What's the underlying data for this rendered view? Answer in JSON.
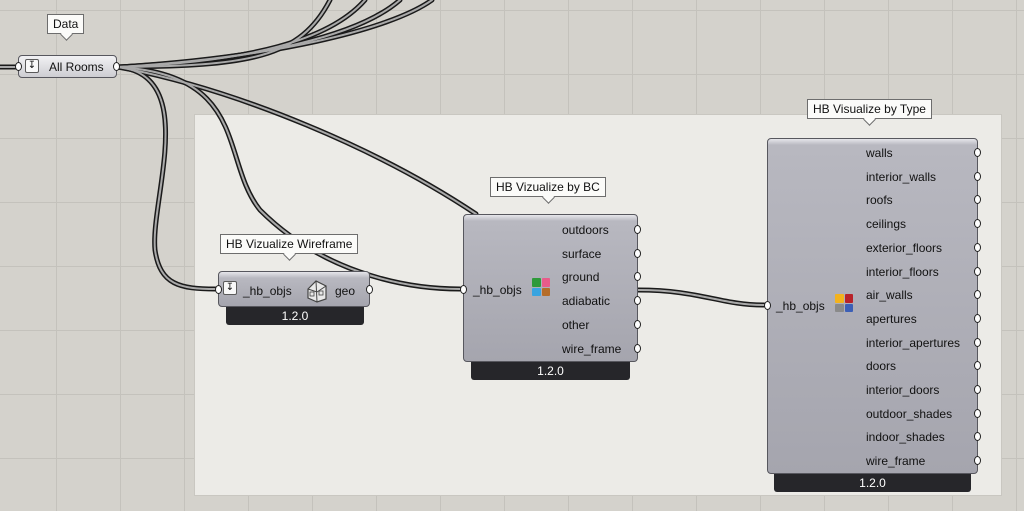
{
  "data_param": {
    "tag": "Data",
    "label": "All Rooms"
  },
  "wireframe": {
    "tag": "HB Vizualize Wireframe",
    "input": "_hb_objs",
    "output": "geo",
    "version": "1.2.0",
    "icon": "house-icon"
  },
  "by_bc": {
    "tag": "HB Vizualize by BC",
    "input": "_hb_objs",
    "outputs": [
      "outdoors",
      "surface",
      "ground",
      "adiabatic",
      "other",
      "wire_frame"
    ],
    "version": "1.2.0",
    "icon_colors": [
      "#2e9a3a",
      "#e85c8a",
      "#39a4e0",
      "#b56d2a"
    ]
  },
  "by_type": {
    "tag": "HB Visualize by Type",
    "input": "_hb_objs",
    "outputs": [
      "walls",
      "interior_walls",
      "roofs",
      "ceilings",
      "exterior_floors",
      "interior_floors",
      "air_walls",
      "apertures",
      "interior_apertures",
      "doors",
      "interior_doors",
      "outdoor_shades",
      "indoor_shades",
      "wire_frame"
    ],
    "version": "1.2.0",
    "icon_colors": [
      "#f3b21d",
      "#b8232a",
      "#8a8a8a",
      "#3c5fb6"
    ]
  }
}
